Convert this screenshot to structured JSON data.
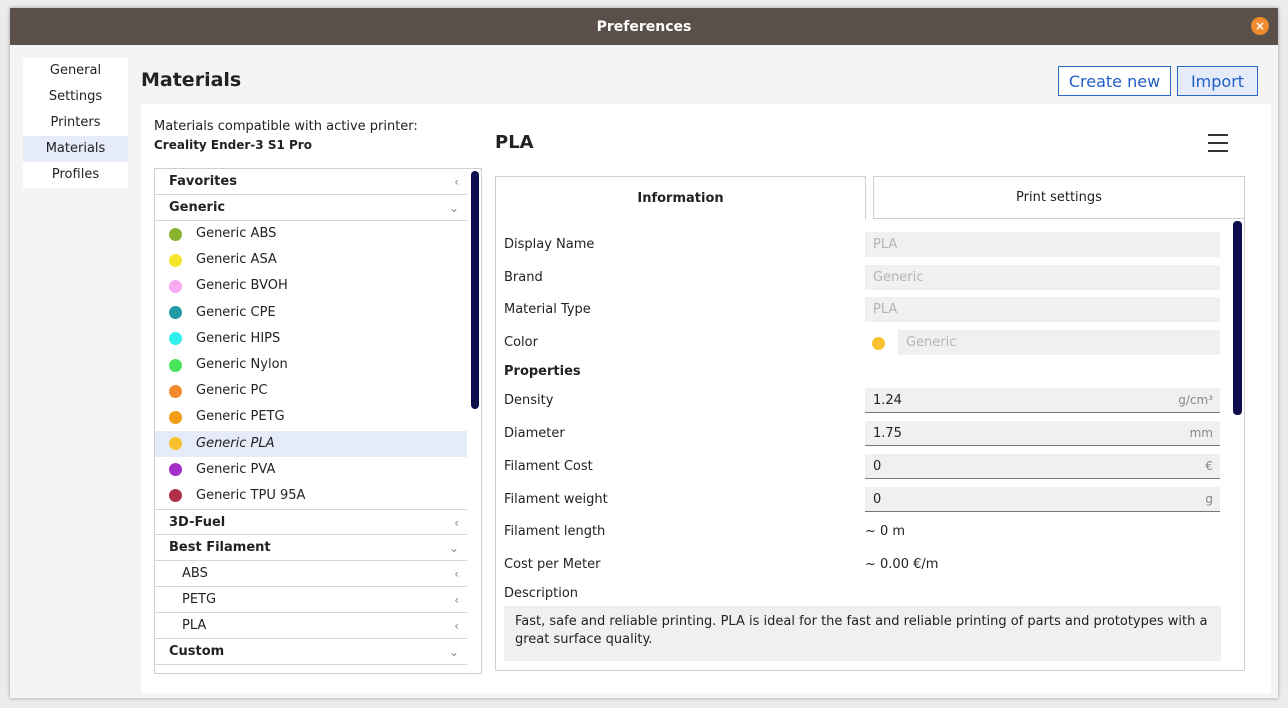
{
  "window": {
    "title": "Preferences",
    "close_glyph": "×"
  },
  "nav": {
    "items": [
      {
        "label": "General"
      },
      {
        "label": "Settings"
      },
      {
        "label": "Printers"
      },
      {
        "label": "Materials",
        "active": true
      },
      {
        "label": "Profiles"
      }
    ]
  },
  "page": {
    "title": "Materials"
  },
  "toolbar": {
    "create_label": "Create new",
    "import_label": "Import"
  },
  "compat": {
    "label": "Materials compatible with active printer:",
    "printer": "Creality Ender-3 S1 Pro"
  },
  "list": {
    "favorites": "Favorites",
    "generic": "Generic",
    "generic_items": [
      {
        "name": "Generic ABS",
        "color": "#8ab32e"
      },
      {
        "name": "Generic ASA",
        "color": "#f5e72d"
      },
      {
        "name": "Generic BVOH",
        "color": "#f8a9f2"
      },
      {
        "name": "Generic CPE",
        "color": "#1f9aa6"
      },
      {
        "name": "Generic HIPS",
        "color": "#2ff0ec"
      },
      {
        "name": "Generic Nylon",
        "color": "#47e45c"
      },
      {
        "name": "Generic PC",
        "color": "#f08a2c"
      },
      {
        "name": "Generic PETG",
        "color": "#f39c18"
      },
      {
        "name": "Generic PLA",
        "color": "#fbc02d",
        "active": true
      },
      {
        "name": "Generic PVA",
        "color": "#a32ec9"
      },
      {
        "name": "Generic TPU 95A",
        "color": "#b0304a"
      }
    ],
    "fuel": "3D-Fuel",
    "best": "Best Filament",
    "best_sub": [
      "ABS",
      "PETG",
      "PLA"
    ],
    "custom": "Custom",
    "chev_collapsed": "‹",
    "chev_expanded": "⌄"
  },
  "material": {
    "name": "PLA",
    "tabs": {
      "info": "Information",
      "print": "Print settings"
    },
    "labels": {
      "display_name": "Display Name",
      "brand": "Brand",
      "material_type": "Material Type",
      "color": "Color",
      "properties": "Properties",
      "density": "Density",
      "diameter": "Diameter",
      "filament_cost": "Filament Cost",
      "filament_weight": "Filament weight",
      "filament_length": "Filament length",
      "cost_per_meter": "Cost per Meter",
      "description": "Description"
    },
    "values": {
      "display_name": "PLA",
      "brand": "Generic",
      "material_type": "PLA",
      "color_name": "Generic",
      "color_hex": "#fbc02d",
      "density": "1.24",
      "density_unit": "g/cm³",
      "diameter": "1.75",
      "diameter_unit": "mm",
      "filament_cost": "0",
      "cost_unit": "€",
      "filament_weight": "0",
      "weight_unit": "g",
      "filament_length": "~ 0 m",
      "cost_per_meter": "~ 0.00 €/m",
      "description": "Fast, safe and reliable printing. PLA is ideal for the fast and reliable printing of parts and prototypes with a great surface quality."
    }
  }
}
